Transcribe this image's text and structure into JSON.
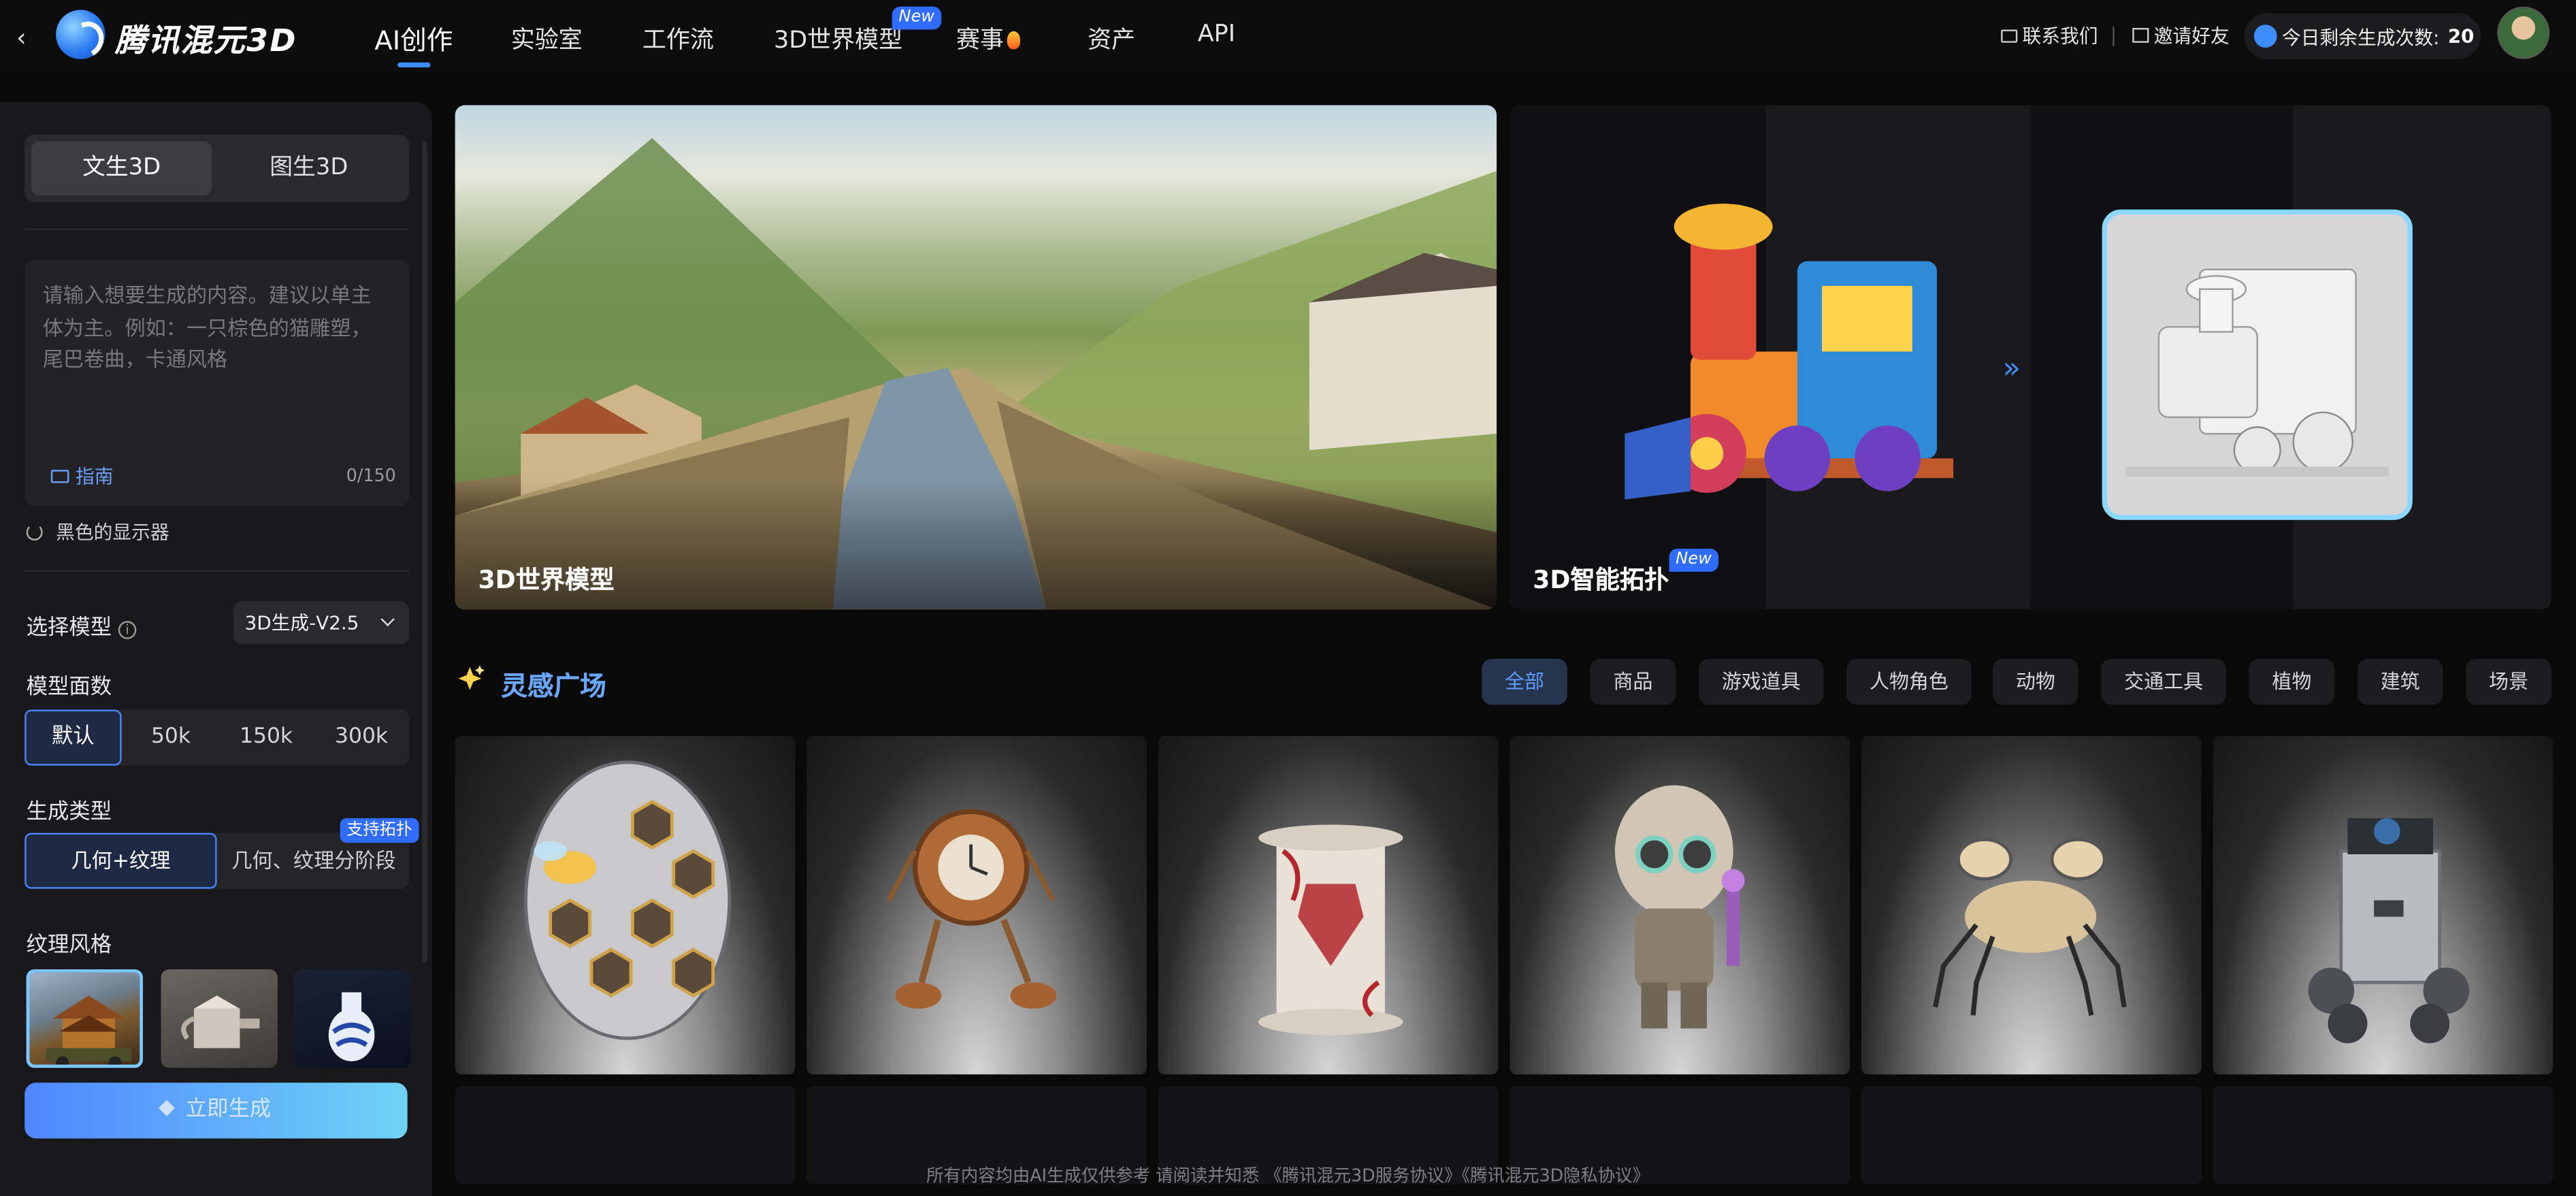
{
  "header": {
    "back_glyph": "‹",
    "logo_text": "腾讯混元3D",
    "nav": [
      {
        "label": "AI创作"
      },
      {
        "label": "实验室"
      },
      {
        "label": "工作流"
      },
      {
        "label": "3D世界模型",
        "badge": "New"
      },
      {
        "label": "赛事"
      },
      {
        "label": "资产"
      },
      {
        "label": "API"
      }
    ],
    "contact": "联系我们",
    "invite": "邀请好友",
    "quota_label": "今日剩余生成次数:",
    "quota_value": "20"
  },
  "sidebar": {
    "tabs": [
      "文生3D",
      "图生3D"
    ],
    "prompt_placeholder": "请输入想要生成的内容。建议以单主体为主。例如：一只棕色的猫雕塑，尾巴卷曲，卡通风格",
    "guide_label": "指南",
    "char_counter": "0/150",
    "suggestion": "黑色的显示器",
    "model_label": "选择模型",
    "model_value": "3D生成-V2.5",
    "faces_label": "模型面数",
    "faces_options": [
      "默认",
      "50k",
      "150k",
      "300k"
    ],
    "gen_type_label": "生成类型",
    "gen_type_options": [
      "几何+纹理",
      "几何、纹理分阶段"
    ],
    "gen_type_badge": "支持拓扑",
    "texture_label": "纹理风格",
    "texture_styles": [
      "pagoda-vehicle",
      "teapot",
      "blue-white-vase"
    ],
    "generate_button": "立即生成"
  },
  "banners": [
    {
      "title": "3D世界模型"
    },
    {
      "title": "3D智能拓扑",
      "badge": "New"
    }
  ],
  "gallery": {
    "title": "灵感广场",
    "filters": [
      "全部",
      "商品",
      "游戏道具",
      "人物角色",
      "动物",
      "交通工具",
      "植物",
      "建筑",
      "场景"
    ],
    "active_filter": "全部",
    "items": [
      "honeycomb-shield",
      "clock-robot",
      "scroll",
      "hooded-astronaut",
      "crab-robot",
      "tower-rover"
    ]
  },
  "footer": {
    "text": "所有内容均由AI生成仅供参考 请阅读并知悉 《腾讯混元3D服务协议》《腾讯混元3D隐私协议》"
  },
  "colors": {
    "accent": "#3f8cff",
    "background": "#09090a",
    "panel": "#19191b"
  }
}
